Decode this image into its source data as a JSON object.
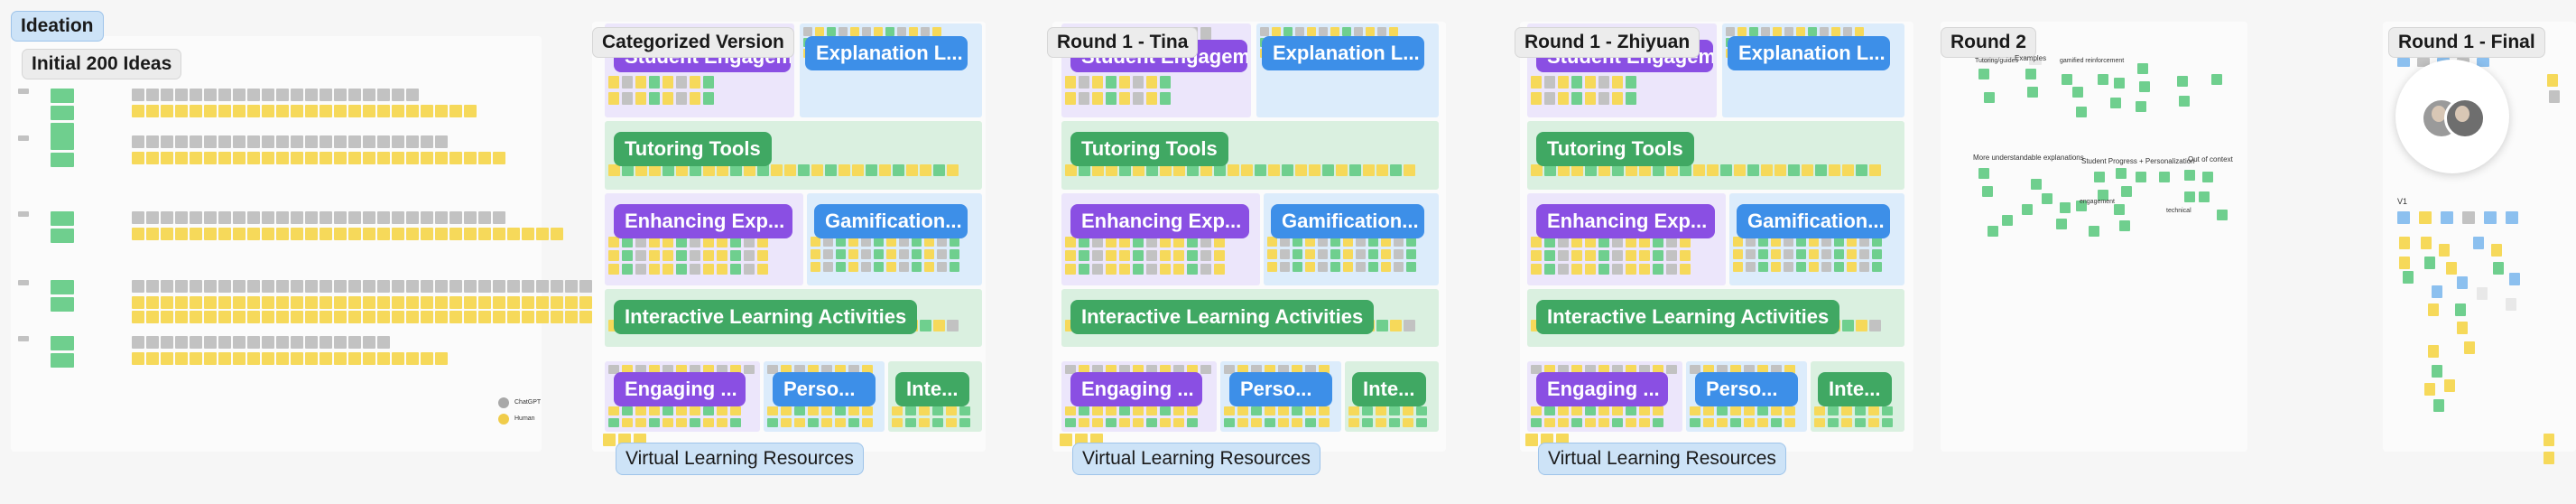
{
  "frames": {
    "ideation": "Ideation",
    "initial_ideas": "Initial 200 Ideas",
    "categorized": "Categorized Version",
    "round1_tina": "Round 1 - Tina",
    "round1_zhiyuan": "Round 1 - Zhiyuan",
    "round2": "Round 2",
    "round1_final": "Round 1 - Final"
  },
  "categorized": {
    "student_engagement": "Student Engagement",
    "explanation": "Explanation L...",
    "tutoring_tools": "Tutoring Tools",
    "enhancing_exp": "Enhancing Exp...",
    "gamification": "Gamification...",
    "interactive_learning": "Interactive Learning Activities",
    "engaging": "Engaging ...",
    "perso": "Perso...",
    "inte": "Inte...",
    "virtual_resources": "Virtual Learning Resources"
  },
  "ideation_legend": [
    {
      "label": "ChatGPT",
      "color": "#a8a8a8"
    },
    {
      "label": "Human",
      "color": "#f0cc4a"
    }
  ],
  "round2_labels": {
    "top_1": "Tutoring/guides",
    "top_2": "Examples",
    "top_3": "gamified reinforcement",
    "top_4": "",
    "more_explanations": "More understandable explanations",
    "progress": "Student Progress + Personalization",
    "out_of_context": "Out of context",
    "engagement": "engagement",
    "technical": "technical"
  },
  "final_labels": {
    "v1": "V1"
  },
  "colors": {
    "purple": "#8a4fe3",
    "blue": "#3d8fe8",
    "green": "#40a863",
    "sticky_yellow": "#f6d95a",
    "sticky_gray": "#c2c2c2",
    "sticky_green": "#6fcf8e"
  },
  "collaborators": [
    "avatar-1",
    "avatar-2"
  ]
}
